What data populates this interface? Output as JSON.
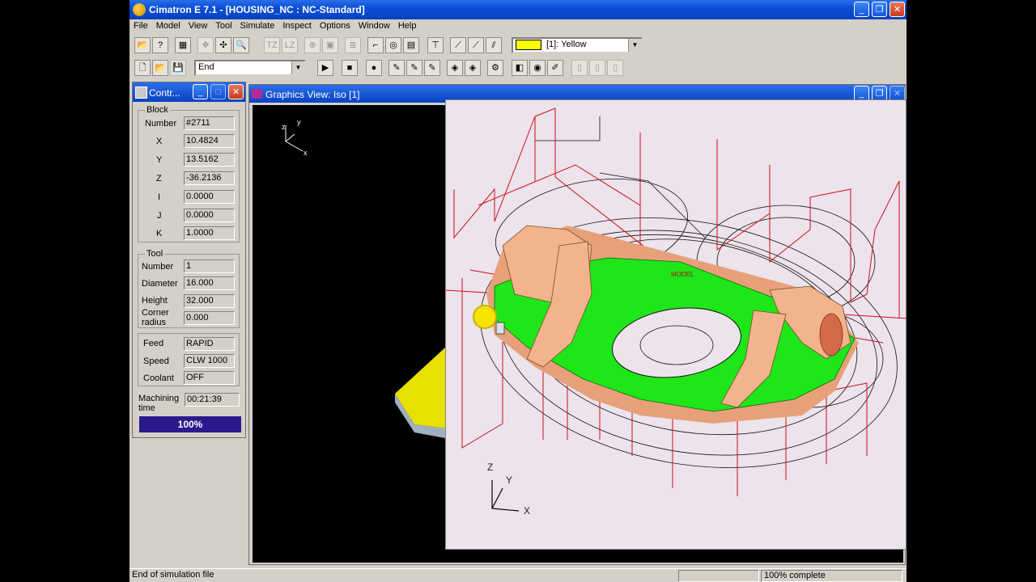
{
  "window": {
    "title": "Cimatron E 7.1 - [HOUSING_NC : NC-Standard]"
  },
  "menu": [
    "File",
    "Model",
    "View",
    "Tool",
    "Simulate",
    "Inspect",
    "Options",
    "Window",
    "Help"
  ],
  "toolbar": {
    "color_combo": "[1]: Yellow",
    "simulation_combo": "End"
  },
  "control_panel": {
    "title": "Contr...",
    "block": {
      "legend": "Block",
      "number_label": "Number",
      "number": "#2711",
      "x_label": "X",
      "x": "10.4824",
      "y_label": "Y",
      "y": "13.5162",
      "z_label": "Z",
      "z": "-36.2136",
      "i_label": "I",
      "i": "0.0000",
      "j_label": "J",
      "j": "0.0000",
      "k_label": "K",
      "k": "1.0000"
    },
    "tool": {
      "legend": "Tool",
      "number_label": "Number",
      "number": "1",
      "diameter_label": "Diameter",
      "diameter": "16.000",
      "height_label": "Height",
      "height": "32.000",
      "corner_label_1": "Corner",
      "corner_label_2": "radius",
      "corner_radius": "0.000"
    },
    "motion": {
      "feed_label": "Feed",
      "feed": "RAPID",
      "speed_label": "Speed",
      "speed": "CLW 1000",
      "coolant_label": "Coolant",
      "coolant": "OFF"
    },
    "machining_label_1": "Machining",
    "machining_label_2": "time",
    "machining_time": "00:21:39",
    "progress": 1.0,
    "progress_text": "100%"
  },
  "graphics_view": {
    "title": "Graphics View: Iso [1]",
    "axis_small": {
      "z": "z",
      "y": "y",
      "x": "x"
    },
    "axis_large": {
      "z": "Z",
      "y": "Y",
      "x": "X"
    },
    "model_label": "MODEL"
  },
  "status": {
    "message": "End of simulation file",
    "progress_text": "100% complete"
  },
  "colors": {
    "accent": "#0842c0",
    "part_green": "#1ee619",
    "part_copper": "#f2b48c",
    "toolpath": "#cc1010",
    "progress": "#2a1a8c"
  }
}
